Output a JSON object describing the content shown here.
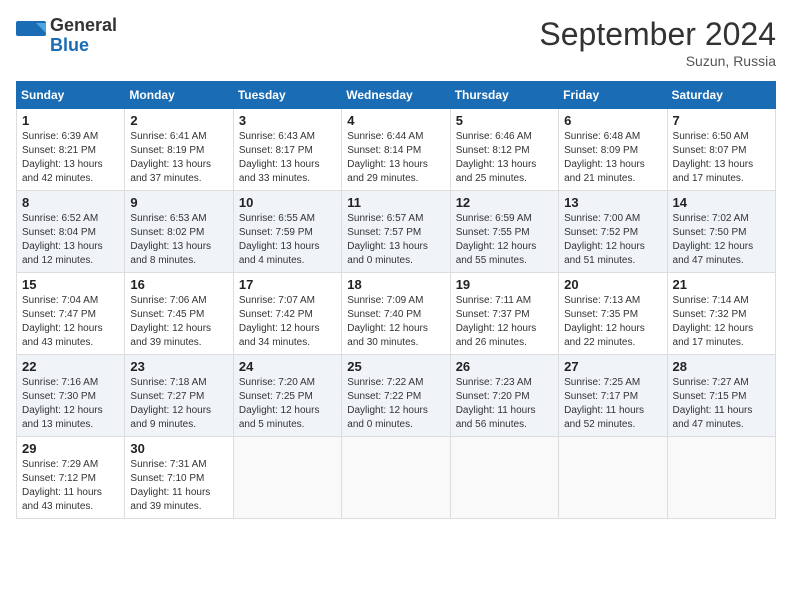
{
  "header": {
    "logo_line1": "General",
    "logo_line2": "Blue",
    "month_title": "September 2024",
    "location": "Suzun, Russia"
  },
  "weekdays": [
    "Sunday",
    "Monday",
    "Tuesday",
    "Wednesday",
    "Thursday",
    "Friday",
    "Saturday"
  ],
  "weeks": [
    [
      {
        "day": "1",
        "info": "Sunrise: 6:39 AM\nSunset: 8:21 PM\nDaylight: 13 hours\nand 42 minutes."
      },
      {
        "day": "2",
        "info": "Sunrise: 6:41 AM\nSunset: 8:19 PM\nDaylight: 13 hours\nand 37 minutes."
      },
      {
        "day": "3",
        "info": "Sunrise: 6:43 AM\nSunset: 8:17 PM\nDaylight: 13 hours\nand 33 minutes."
      },
      {
        "day": "4",
        "info": "Sunrise: 6:44 AM\nSunset: 8:14 PM\nDaylight: 13 hours\nand 29 minutes."
      },
      {
        "day": "5",
        "info": "Sunrise: 6:46 AM\nSunset: 8:12 PM\nDaylight: 13 hours\nand 25 minutes."
      },
      {
        "day": "6",
        "info": "Sunrise: 6:48 AM\nSunset: 8:09 PM\nDaylight: 13 hours\nand 21 minutes."
      },
      {
        "day": "7",
        "info": "Sunrise: 6:50 AM\nSunset: 8:07 PM\nDaylight: 13 hours\nand 17 minutes."
      }
    ],
    [
      {
        "day": "8",
        "info": "Sunrise: 6:52 AM\nSunset: 8:04 PM\nDaylight: 13 hours\nand 12 minutes."
      },
      {
        "day": "9",
        "info": "Sunrise: 6:53 AM\nSunset: 8:02 PM\nDaylight: 13 hours\nand 8 minutes."
      },
      {
        "day": "10",
        "info": "Sunrise: 6:55 AM\nSunset: 7:59 PM\nDaylight: 13 hours\nand 4 minutes."
      },
      {
        "day": "11",
        "info": "Sunrise: 6:57 AM\nSunset: 7:57 PM\nDaylight: 13 hours\nand 0 minutes."
      },
      {
        "day": "12",
        "info": "Sunrise: 6:59 AM\nSunset: 7:55 PM\nDaylight: 12 hours\nand 55 minutes."
      },
      {
        "day": "13",
        "info": "Sunrise: 7:00 AM\nSunset: 7:52 PM\nDaylight: 12 hours\nand 51 minutes."
      },
      {
        "day": "14",
        "info": "Sunrise: 7:02 AM\nSunset: 7:50 PM\nDaylight: 12 hours\nand 47 minutes."
      }
    ],
    [
      {
        "day": "15",
        "info": "Sunrise: 7:04 AM\nSunset: 7:47 PM\nDaylight: 12 hours\nand 43 minutes."
      },
      {
        "day": "16",
        "info": "Sunrise: 7:06 AM\nSunset: 7:45 PM\nDaylight: 12 hours\nand 39 minutes."
      },
      {
        "day": "17",
        "info": "Sunrise: 7:07 AM\nSunset: 7:42 PM\nDaylight: 12 hours\nand 34 minutes."
      },
      {
        "day": "18",
        "info": "Sunrise: 7:09 AM\nSunset: 7:40 PM\nDaylight: 12 hours\nand 30 minutes."
      },
      {
        "day": "19",
        "info": "Sunrise: 7:11 AM\nSunset: 7:37 PM\nDaylight: 12 hours\nand 26 minutes."
      },
      {
        "day": "20",
        "info": "Sunrise: 7:13 AM\nSunset: 7:35 PM\nDaylight: 12 hours\nand 22 minutes."
      },
      {
        "day": "21",
        "info": "Sunrise: 7:14 AM\nSunset: 7:32 PM\nDaylight: 12 hours\nand 17 minutes."
      }
    ],
    [
      {
        "day": "22",
        "info": "Sunrise: 7:16 AM\nSunset: 7:30 PM\nDaylight: 12 hours\nand 13 minutes."
      },
      {
        "day": "23",
        "info": "Sunrise: 7:18 AM\nSunset: 7:27 PM\nDaylight: 12 hours\nand 9 minutes."
      },
      {
        "day": "24",
        "info": "Sunrise: 7:20 AM\nSunset: 7:25 PM\nDaylight: 12 hours\nand 5 minutes."
      },
      {
        "day": "25",
        "info": "Sunrise: 7:22 AM\nSunset: 7:22 PM\nDaylight: 12 hours\nand 0 minutes."
      },
      {
        "day": "26",
        "info": "Sunrise: 7:23 AM\nSunset: 7:20 PM\nDaylight: 11 hours\nand 56 minutes."
      },
      {
        "day": "27",
        "info": "Sunrise: 7:25 AM\nSunset: 7:17 PM\nDaylight: 11 hours\nand 52 minutes."
      },
      {
        "day": "28",
        "info": "Sunrise: 7:27 AM\nSunset: 7:15 PM\nDaylight: 11 hours\nand 47 minutes."
      }
    ],
    [
      {
        "day": "29",
        "info": "Sunrise: 7:29 AM\nSunset: 7:12 PM\nDaylight: 11 hours\nand 43 minutes."
      },
      {
        "day": "30",
        "info": "Sunrise: 7:31 AM\nSunset: 7:10 PM\nDaylight: 11 hours\nand 39 minutes."
      },
      {
        "day": "",
        "info": ""
      },
      {
        "day": "",
        "info": ""
      },
      {
        "day": "",
        "info": ""
      },
      {
        "day": "",
        "info": ""
      },
      {
        "day": "",
        "info": ""
      }
    ]
  ]
}
